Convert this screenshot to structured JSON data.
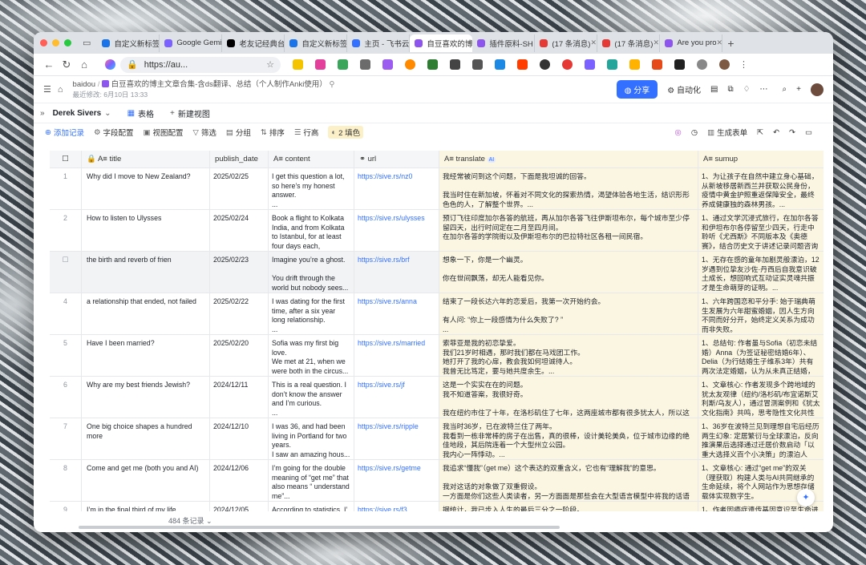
{
  "tabs": [
    {
      "label": "自定义新标签",
      "color": "#1a73e8"
    },
    {
      "label": "Google Gemini",
      "color": "#7b61ff"
    },
    {
      "label": "老友记经典台词",
      "color": "#000000"
    },
    {
      "label": "自定义新标签",
      "color": "#1a73e8"
    },
    {
      "label": "主页 - 飞书云",
      "color": "#3370ff"
    },
    {
      "label": "自豆喜欢的博",
      "color": "#8d55ed"
    },
    {
      "label": "插件原料-SH",
      "color": "#8d55ed"
    },
    {
      "label": "(17 条消息)",
      "color": "#e53935"
    },
    {
      "label": "(17 条消息)",
      "color": "#e53935"
    },
    {
      "label": "Are you pro",
      "color": "#8d55ed"
    }
  ],
  "address": {
    "url": "https://au..."
  },
  "doc": {
    "space": "baidou",
    "title": "白豆喜欢的博主文章合集-含ds翻译、总结（个人制作Anki使用）",
    "modified": "最近修改: 6月10日 13:33",
    "share": "分享",
    "automation": "自动化"
  },
  "view": {
    "owner": "Derek Sivers",
    "table_tab": "表格",
    "new_view": "新建视图"
  },
  "toolbar": {
    "add": "添加记录",
    "fields": "字段配置",
    "view_config": "视图配置",
    "filter": "筛选",
    "group": "分组",
    "sort": "排序",
    "row_height": "行高",
    "fill": "2 填色",
    "form": "生成表单"
  },
  "columns": {
    "title": "title",
    "date": "publish_date",
    "content": "content",
    "url": "url",
    "translate": "translate",
    "sumup": "sumup",
    "ai": "AI"
  },
  "rows": [
    {
      "n": "1",
      "title": "Why did I move to New Zealand?",
      "date": "2025/02/25",
      "content": "I get this question a lot, so here’s my honest answer.\n...",
      "url": "https://sive.rs/nz0",
      "translate": "我经常被问到这个问题，下面是我坦诚的回答。\n\n我当时住在新加坡，怀着对不同文化的探索热情，渴望体验各地生活，结识形形色色的人，了解整个世界。...",
      "sumup": "1、为让孩子在自然中建立身心基础，从新坡移居新西兰并获取公民身份，疫情中黄金护照重返保障安全，最终养成健康独的森林男孩。..."
    },
    {
      "n": "2",
      "title": "How to listen to Ulysses",
      "date": "2025/02/24",
      "content": "Book a flight to Kolkata India, and from Kolkata to Istanbul, for at least four days each, betwee...",
      "url": "https://sive.rs/ulysses",
      "translate": "预订飞往印度加尔各答的航班，再从加尔各答飞往伊斯坦布尔，每个城市至少停留四天，出行时间定在二月至四月间。\n在加尔各答的学院街以及伊斯坦布尔的巴拉特社区各租一间民宿。",
      "sumup": "1、通过文学沉浸式旅行，在加尔各答和伊坦布尔各停留至少四天，行走中聆听《尤西斯》不同版本及《奥德赛》，结合历史文于讲述记录问题咨询专家，最后分享体验。"
    },
    {
      "n": "",
      "title": "the birth and reverb of frien",
      "date": "2025/02/23",
      "content": "Imagine you’re a ghost.\n\nYou drift through the world but nobody sees...",
      "url": "https://sive.rs/brf",
      "translate": "想象一下，你是一个幽灵。\n\n你在世间飘荡，却无人能看见你。",
      "sumup": "1、无存在感的童年加剧灵般漂泊，12岁遇到位挚友沙佐·丹西后自我意识破土成长，想回响式互动证实灵魂共振才是生命萌芽的证明。..."
    },
    {
      "n": "4",
      "title": "a relationship that ended, not failed",
      "date": "2025/02/22",
      "content": "I was dating for the first time, after a six year long relationship.\n...",
      "url": "https://sive.rs/anna",
      "translate": "结束了一段长达六年的恋爱后，我第一次开始约会。\n\n有人问: “你上一段感情为什么失败了? ”\n...",
      "sumup": "1、六年跨国恋和平分手: 始于瑞典萌生发展为六年甜蜜婚姻，因人生方向不同而好分开，始终定义关系为成功而非失败。"
    },
    {
      "n": "5",
      "title": "Have I been married?",
      "date": "2025/02/20",
      "content": "Sofia was my first big love.\nWe met at 21, when we were both in the circus...",
      "url": "https://sive.rs/married",
      "translate": "索菲亚是我的初恋挚爱。\n我们21岁时相遇，那时我们都在马戏团工作。\n她打开了我的心扉，教会我如何坦诚待人。\n我曾无比笃定，要与她共度余生。...",
      "sumup": "1、总结句: 作者虽与Sofia（初恋未结婚）Anna（为签证秘密结婚6年）、Delia（为行结婚生子维系3年）共有两次法定婚姻，认为从未真正结婚，仅将证书视为跨国生活共。"
    },
    {
      "n": "6",
      "title": "Why are my best friends Jewish?",
      "date": "2024/12/11",
      "content": "This is a real question. I don’t know the answer and I’m curious.\n...",
      "url": "https://sive.rs/jf",
      "translate": "这是一个实实在在的问题。\n我不知道答案，我很好奇。\n\n我在纽约市住了十年，在洛杉矶住了七年，这两座城市都有很多犹太人，所以这可能只...",
      "sumup": "1、文章核心: 作者发现多个跨地域的犹太友观律（纽约/洛杉矶/布宜诺斯艾利斯/乌友人），通过冒测案例和《犹太文化指南》共鸣，思考隐性文化共性（讨论传统/世界"
    },
    {
      "n": "7",
      "title": "One big choice shapes a hundred more",
      "date": "2024/12/10",
      "content": "I was 36, and had been living in Portland for two years.\nI saw an amazing hous...",
      "url": "https://sive.rs/ripple",
      "translate": "我当时36岁，已在波特兰住了两年。\n我看到一栋非常棒的房子在出售，真的很棒，设计美轮美奂，位于城市边缘的绝佳地段，其后院连着一个大型州立公园。\n我内心一阵悸动。...",
      "sumup": "1、36岁在波特兰见到理想自宅后经历两生幻象: 定居繁衍与全球漂泊，反向推演果后选择通过迁居价数启动「以重大选择义百个小决策」的漂泊人生。"
    },
    {
      "n": "8",
      "title": "Come and get me (both you and AI)",
      "date": "2024/12/06",
      "content": "I’m going for the double meaning of “get me” that also means “ understand me”...",
      "url": "https://sive.rs/getme",
      "translate": "我追求“懂我”（get me）这个表达的双重含义，它也有“理解我”的意思。\n\n我对这话的对象做了双重假设。\n一方面是你们这些人类读者，另一方面面是那些会在大型语言模型中将我的话语解析为...",
      "sumup": "1、文章核心: 通过“get me”的双关（理获取）构建人类与AI共同继承的生命延续，将个人网站作为思想存储载体实现数字生。"
    },
    {
      "n": "9",
      "title": "I’m in the final third of my life",
      "date": "2024/12/05",
      "content": "According to statistics, I’",
      "url": "https://sive.rs/f3",
      "translate": "据统计，我已步入人生的最后三分之一阶段。",
      "sumup": "1、作者因癌症遗传基因意识至生命进入”"
    }
  ],
  "footer": {
    "count": "484 条记录"
  }
}
